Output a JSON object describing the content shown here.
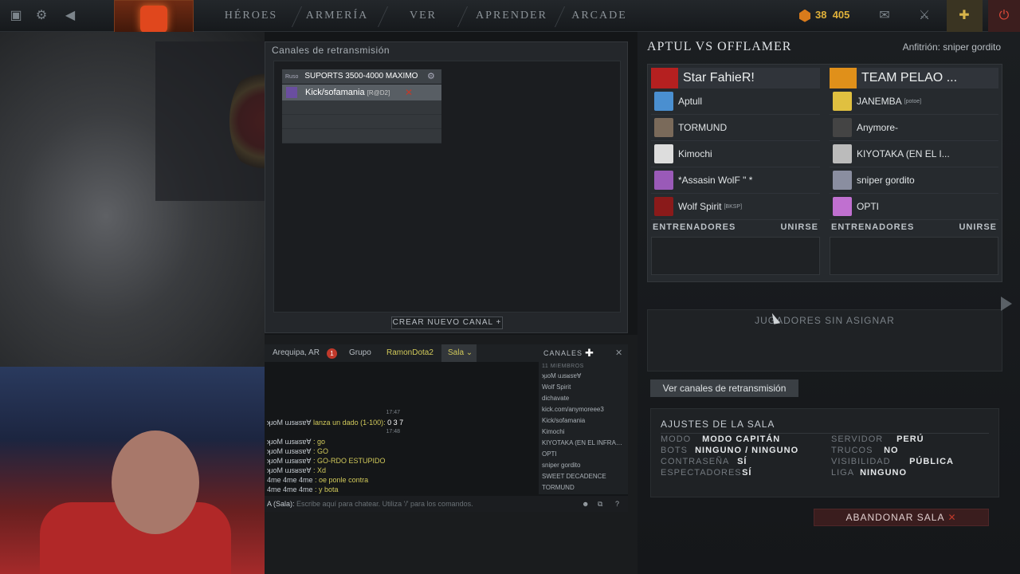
{
  "topbar": {
    "nav": [
      "HÉROES",
      "ARMERÍA",
      "VER",
      "APRENDER",
      "ARCADE"
    ],
    "gold_a": "38",
    "gold_b": "405"
  },
  "broadcast": {
    "title": "Canales de retransmisión",
    "channel_lang": "Ruso",
    "channel_name": "SUPORTS 3500-4000 MAXIMO",
    "caster_name": "Kick/sofamania",
    "caster_tag": "[R@D2]",
    "new_channel_label": "CREAR NUEVO CANAL"
  },
  "chat": {
    "tabs": {
      "location": "Arequipa, AR",
      "location_badge": "1",
      "group": "Grupo",
      "user": "RamonDota2",
      "room": "Sala",
      "channels": "CANALES"
    },
    "lines": [
      {
        "ts": "17:47"
      },
      {
        "who": "ʞɹoM uɹsʁsɐ∀",
        "msg": " lanza un dado (1-100):",
        "extra": " 0 3 7",
        "type": "dice"
      },
      {
        "ts": "17:48"
      },
      {
        "who": "ʞɹoM uɹsʁsɐ∀",
        "msg": " : go"
      },
      {
        "who": "ʞɹoM uɹsʁsɐ∀",
        "msg": " : GO"
      },
      {
        "who": "ʞɹoM uɹsʁsɐ∀",
        "msg": " : GO-RDO ESTUPIDO"
      },
      {
        "who": "ʞɹoM uɹsʁsɐ∀",
        "msg": " : Xd"
      },
      {
        "who": "4me 4me 4me",
        "msg": " : oe ponle contra"
      },
      {
        "who": "4me 4me 4me",
        "msg": " : y bota"
      }
    ],
    "members_header": "11 MIEMBROS",
    "members": [
      "ʞɹoM uɹsʁsɐ∀",
      "Wolf Spirit",
      "dichavate",
      "kick.com/anymoreee3",
      "Kick/sofamania",
      "Kimochi",
      "KIYOTAKA (EN EL INFRAM...",
      "OPTI",
      "sniper gordito",
      "SWEET DECADENCE",
      "TORMUND"
    ],
    "input_prefix": "A (Sala):",
    "input_placeholder": "Escribe aquí para chatear. Utiliza '/' para los comandos."
  },
  "lobby": {
    "title": "APTUL VS OFFLAMER",
    "host": "Anfitrión: sniper gordito",
    "team_left": {
      "name": "Star FahieR!",
      "players": [
        {
          "name": "Aptull",
          "tag": "",
          "color": "#4a8fd0"
        },
        {
          "name": "TORMUND",
          "tag": "",
          "color": "#7a6a5a"
        },
        {
          "name": "Kimochi",
          "tag": "",
          "color": "#ddd"
        },
        {
          "name": "*Assasin WolF \" *",
          "tag": "",
          "color": "#9a5ab8"
        },
        {
          "name": "Wolf Spirit",
          "tag": "[BKSP]",
          "color": "#8a1a1a"
        }
      ]
    },
    "team_right": {
      "name": "TEAM PELAO ...",
      "players": [
        {
          "name": "JANEMBA",
          "tag": "[potoe]",
          "color": "#e0c040"
        },
        {
          "name": "Anymore-",
          "tag": "",
          "color": "#444"
        },
        {
          "name": "KIYOTAKA (EN EL I...",
          "tag": "",
          "color": "#bbb"
        },
        {
          "name": "sniper gordito",
          "tag": "",
          "color": "#8a8ea0"
        },
        {
          "name": "OPTI",
          "tag": "",
          "color": "#c070d0"
        }
      ]
    },
    "coaches_label": "ENTRENADORES",
    "join_label": "UNIRSE",
    "unassigned_label": "JUGADORES SIN ASIGNAR",
    "view_channels": "Ver canales de retransmisión",
    "settings": {
      "title": "AJUSTES DE LA SALA",
      "left": [
        {
          "k": "MODO",
          "v": "MODO CAPITÁN"
        },
        {
          "k": "BOTS",
          "v": "NINGUNO / NINGUNO"
        },
        {
          "k": "CONTRASEÑA",
          "v": "SÍ"
        },
        {
          "k": "ESPECTADORES",
          "v": "SÍ"
        }
      ],
      "right": [
        {
          "k": "SERVIDOR",
          "v": "PERÚ"
        },
        {
          "k": "TRUCOS",
          "v": "NO"
        },
        {
          "k": "VISIBILIDAD",
          "v": "PÚBLICA"
        },
        {
          "k": "LIGA",
          "v": "NINGUNO"
        }
      ]
    },
    "leave_label": "ABANDONAR SALA"
  },
  "colors": {
    "accent_red": "#c0392b",
    "gold": "#e0b13a"
  },
  "icons": [
    "dashboard-icon",
    "gear-icon",
    "back-arrow-icon",
    "mail-icon",
    "armory-icon",
    "plus-icon",
    "power-icon",
    "channel-settings-icon",
    "close-icon",
    "emoji-icon",
    "popout-icon",
    "help-icon"
  ]
}
